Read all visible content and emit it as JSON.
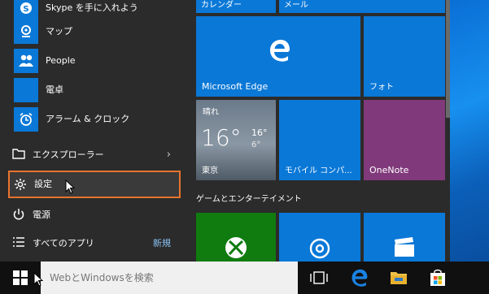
{
  "start_menu": {
    "apps": [
      {
        "label": "Skype を手に入れよう",
        "icon": "skype-icon"
      },
      {
        "label": "マップ",
        "icon": "maps-icon"
      },
      {
        "label": "People",
        "icon": "people-icon"
      },
      {
        "label": "電卓",
        "icon": "calculator-icon"
      },
      {
        "label": "アラーム & クロック",
        "icon": "alarm-icon"
      }
    ],
    "system": {
      "explorer": "エクスプローラー",
      "settings": "設定",
      "power": "電源",
      "all_apps": "すべてのアプリ",
      "all_apps_badge": "新規"
    }
  },
  "tiles": {
    "calendar_label": "カレンダー",
    "mail_label": "メール",
    "edge_label": "Microsoft Edge",
    "photos_label": "フォト",
    "weather": {
      "condition": "晴れ",
      "temp": "16°",
      "high": "16°",
      "low": "6°",
      "city": "東京"
    },
    "mobile_label": "モバイル コンパ...",
    "onenote_label": "OneNote",
    "group_header": "ゲームとエンターテイメント"
  },
  "taskbar": {
    "search_placeholder": "WebとWindowsを検索"
  },
  "colors": {
    "tile_blue": "#0a78d7",
    "onenote_purple": "#80397b",
    "xbox_green": "#107c10",
    "highlight_orange": "#e8732e"
  }
}
